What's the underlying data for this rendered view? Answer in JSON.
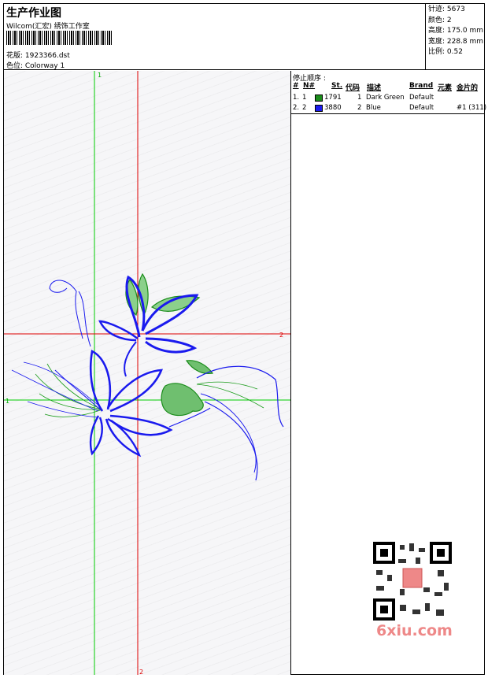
{
  "header": {
    "title": "生产作业图",
    "company": "Wilcom(汇宏) 绣饰工作室",
    "pattern": "花版: 1923366.dst",
    "colorway": "色位: Colorway 1"
  },
  "stats": {
    "stitches": "针迹: 5673",
    "colors": "颜色: 2",
    "height": "高度: 175.0 mm",
    "width": "宽度: 228.8 mm",
    "scale": "比例: 0.52"
  },
  "stop_sequence": {
    "title": "停止顺序 :",
    "headers": {
      "num": "#",
      "n": "N#",
      "st": "St.",
      "code": "代码",
      "desc": "描述",
      "brand": "Brand",
      "elem": "元素",
      "seq": "金片的"
    },
    "rows": [
      {
        "num": "1.",
        "n": "1",
        "color": "#1a8c1a",
        "st": "1791",
        "code": "1",
        "desc": "Dark Green",
        "brand": "Default",
        "seq": ""
      },
      {
        "num": "2.",
        "n": "2",
        "color": "#1a1aee",
        "st": "3880",
        "code": "2",
        "desc": "Blue",
        "brand": "Default",
        "seq": "#1 (311)"
      }
    ]
  },
  "markers": {
    "green": "1",
    "red": "2"
  },
  "watermark": "6xiu.com"
}
